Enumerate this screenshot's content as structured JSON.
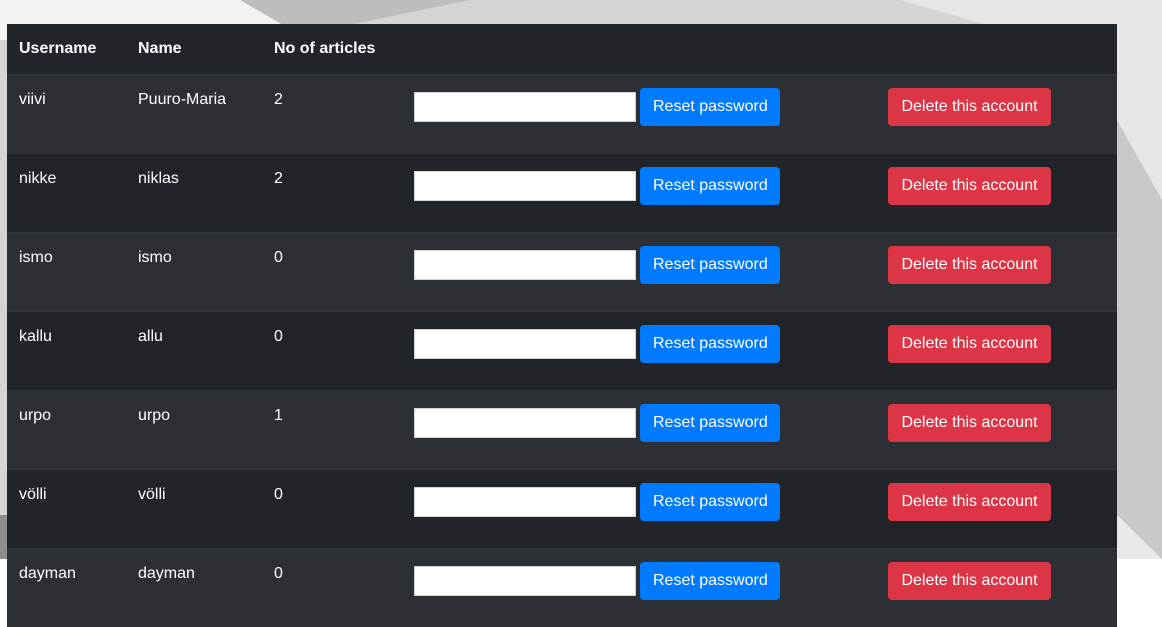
{
  "colors": {
    "table_bg": "#212529",
    "striped_row_bg": "#2c3034",
    "primary": "#007bff",
    "danger": "#dc3545"
  },
  "table": {
    "headers": {
      "username": "Username",
      "name": "Name",
      "articles": "No of articles"
    },
    "rows": [
      {
        "username": "viivi",
        "name": "Puuro-Maria",
        "articles": "2",
        "password": "",
        "reset_label": "Reset password",
        "delete_label": "Delete this account"
      },
      {
        "username": "nikke",
        "name": "niklas",
        "articles": "2",
        "password": "",
        "reset_label": "Reset password",
        "delete_label": "Delete this account"
      },
      {
        "username": "ismo",
        "name": "ismo",
        "articles": "0",
        "password": "",
        "reset_label": "Reset password",
        "delete_label": "Delete this account"
      },
      {
        "username": "kallu",
        "name": "allu",
        "articles": "0",
        "password": "",
        "reset_label": "Reset password",
        "delete_label": "Delete this account"
      },
      {
        "username": "urpo",
        "name": "urpo",
        "articles": "1",
        "password": "",
        "reset_label": "Reset password",
        "delete_label": "Delete this account"
      },
      {
        "username": "völli",
        "name": "völli",
        "articles": "0",
        "password": "",
        "reset_label": "Reset password",
        "delete_label": "Delete this account"
      },
      {
        "username": "dayman",
        "name": "dayman",
        "articles": "0",
        "password": "",
        "reset_label": "Reset password",
        "delete_label": "Delete this account"
      }
    ]
  }
}
